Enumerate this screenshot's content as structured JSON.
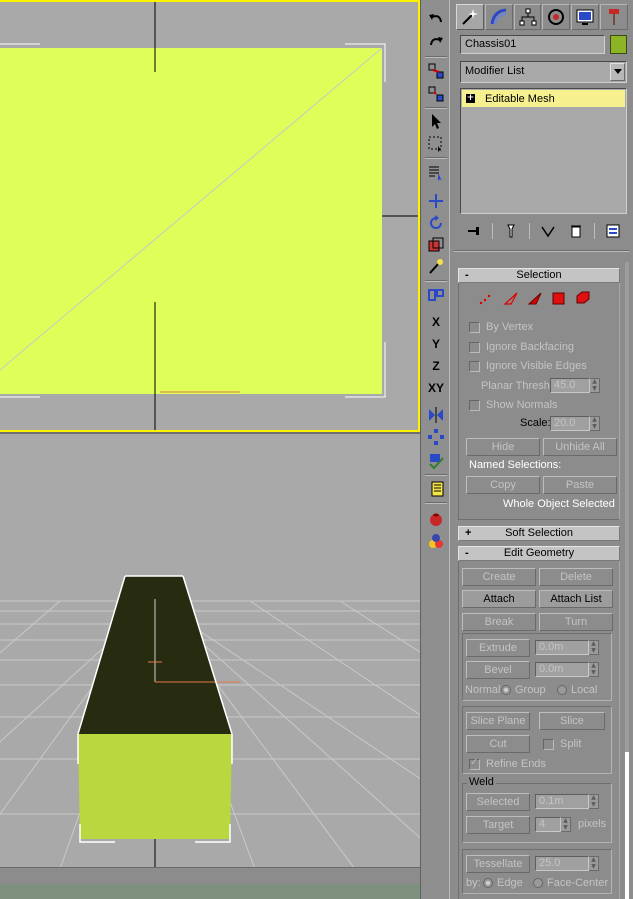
{
  "object": {
    "name": "Chassis01",
    "color": "#8bb526"
  },
  "modifier_list": {
    "label": "Modifier List"
  },
  "stack": {
    "items": [
      {
        "label": "Editable Mesh",
        "expand": "+"
      }
    ]
  },
  "command_tabs": [
    {
      "name": "create-tab-icon"
    },
    {
      "name": "modify-tab-icon"
    },
    {
      "name": "hierarchy-tab-icon"
    },
    {
      "name": "motion-tab-icon"
    },
    {
      "name": "display-tab-icon"
    },
    {
      "name": "utilities-tab-icon"
    }
  ],
  "toolbar_axes": {
    "x": "X",
    "y": "Y",
    "z": "Z",
    "xy": "XY"
  },
  "selection": {
    "title": "Selection",
    "sign": "-",
    "by_vertex": "By Vertex",
    "ignore_backfacing": "Ignore Backfacing",
    "ignore_visible_edges": "Ignore Visible Edges",
    "planar_thresh_label": "Planar Thresh:",
    "planar_thresh_value": "45.0",
    "show_normals": "Show Normals",
    "scale_label": "Scale:",
    "scale_value": "20.0",
    "hide": "Hide",
    "unhide_all": "Unhide All",
    "named_selections": "Named Selections:",
    "copy": "Copy",
    "paste": "Paste",
    "status": "Whole Object Selected"
  },
  "soft_selection": {
    "title": "Soft Selection",
    "sign": "+"
  },
  "edit_geometry": {
    "title": "Edit Geometry",
    "sign": "-",
    "create": "Create",
    "delete": "Delete",
    "attach": "Attach",
    "attach_list": "Attach List",
    "break": "Break",
    "turn": "Turn",
    "extrude_label": "Extrude",
    "extrude_value": "0.0m",
    "bevel_label": "Bevel",
    "bevel_value": "0.0m",
    "normal_label": "Normal:",
    "group": "Group",
    "local": "Local",
    "slice_plane": "Slice Plane",
    "slice": "Slice",
    "cut": "Cut",
    "split": "Split",
    "refine_ends": "Refine Ends",
    "weld_title": "Weld",
    "selected": "Selected",
    "selected_value": "0.1m",
    "target": "Target",
    "target_value": "4",
    "pixels": "pixels",
    "tessellate": "Tessellate",
    "tessellate_value": "25.0",
    "by_label": "by:",
    "edge": "Edge",
    "face_center": "Face-Center"
  },
  "colors": {
    "object_face": "#deff5a",
    "object_side": "#b9d73e",
    "object_top": "#272b10",
    "active_viewport_border": "#ffffff",
    "highlight_stack": "#f6f08e"
  }
}
